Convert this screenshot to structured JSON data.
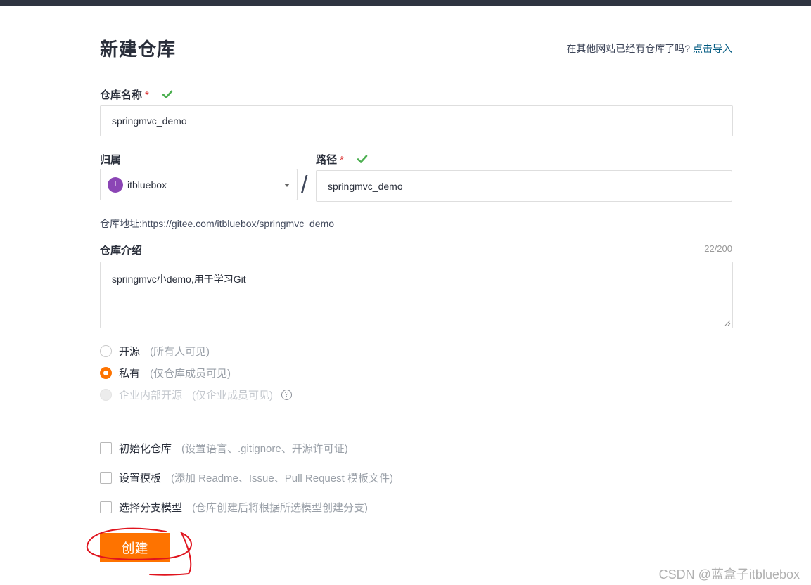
{
  "header": {
    "title": "新建仓库",
    "import_prompt": "在其他网站已经有仓库了吗?",
    "import_link": "点击导入"
  },
  "repo_name": {
    "label": "仓库名称",
    "required_mark": "*",
    "value": "springmvc_demo"
  },
  "owner": {
    "label": "归属",
    "avatar_letter": "I",
    "avatar_color": "#8b45b5",
    "value": "itbluebox"
  },
  "separator": "/",
  "path": {
    "label": "路径",
    "required_mark": "*",
    "value": "springmvc_demo"
  },
  "repo_address": "仓库地址:https://gitee.com/itbluebox/springmvc_demo",
  "description": {
    "label": "仓库介绍",
    "counter": "22/200",
    "value": "springmvc小demo,用于学习Git"
  },
  "visibility": {
    "options": [
      {
        "label": "开源",
        "hint": "(所有人可见)",
        "selected": false,
        "disabled": false
      },
      {
        "label": "私有",
        "hint": "(仅仓库成员可见)",
        "selected": true,
        "disabled": false
      },
      {
        "label": "企业内部开源",
        "hint": "(仅企业成员可见)",
        "selected": false,
        "disabled": true
      }
    ],
    "help_icon": "?"
  },
  "options": [
    {
      "label": "初始化仓库",
      "hint": "(设置语言、.gitignore、开源许可证)",
      "checked": false
    },
    {
      "label": "设置模板",
      "hint": "(添加 Readme、Issue、Pull Request 模板文件)",
      "checked": false
    },
    {
      "label": "选择分支模型",
      "hint": "(仓库创建后将根据所选模型创建分支)",
      "checked": false
    }
  ],
  "submit_label": "创建",
  "watermark": "CSDN @蓝盒子itbluebox",
  "colors": {
    "accent": "#fe7300",
    "check": "#4caf50",
    "link": "#005980",
    "topbar": "#2f3441"
  }
}
